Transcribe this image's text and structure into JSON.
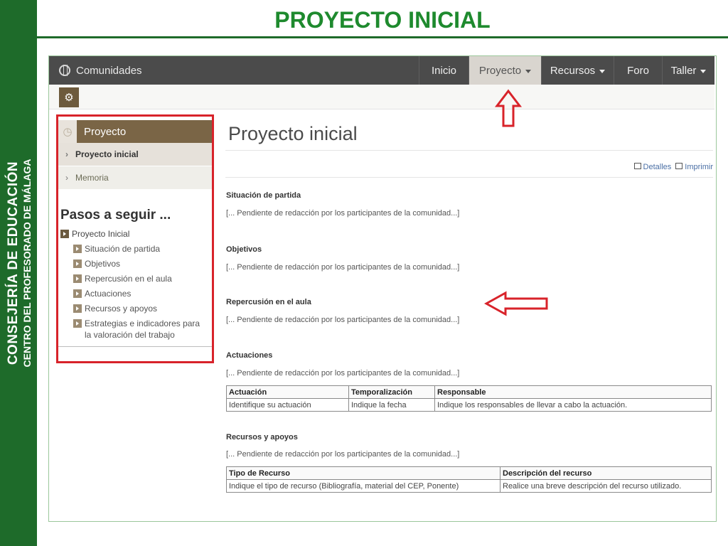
{
  "slide": {
    "title": "PROYECTO INICIAL",
    "band_line1": "CONSEJERÍA DE EDUCACIÓN",
    "band_line2": "CENTRO DEL PROFESORADO DE MÁLAGA"
  },
  "topbar": {
    "brand": "Comunidades",
    "nav": [
      {
        "label": "Inicio",
        "dropdown": false
      },
      {
        "label": "Proyecto",
        "dropdown": true
      },
      {
        "label": "Recursos",
        "dropdown": true
      },
      {
        "label": "Foro",
        "dropdown": false
      },
      {
        "label": "Taller",
        "dropdown": true
      }
    ]
  },
  "left_panel": {
    "header": "Proyecto",
    "items": [
      "Proyecto inicial",
      "Memoria"
    ],
    "pasos_title": "Pasos a seguir ...",
    "root_step": "Proyecto Inicial",
    "steps": [
      "Situación de partida",
      "Objetivos",
      "Repercusión en el aula",
      "Actuaciones",
      "Recursos y apoyos",
      "Estrategias e indicadores para la valoración del trabajo"
    ]
  },
  "main": {
    "title": "Proyecto inicial",
    "actions": {
      "details": "Detalles",
      "print": "Imprimir"
    },
    "pending_text": "[... Pendiente de redacción por los participantes de la comunidad...]",
    "sections": [
      {
        "title": "Situación de partida",
        "text": "[... Pendiente de redacción por los participantes de la comunidad...]"
      },
      {
        "title": "Objetivos",
        "text": "[... Pendiente de redacción por los participantes de la comunidad...]"
      },
      {
        "title": "Repercusión en el aula",
        "text": "[... Pendiente de redacción por los participantes de la comunidad...]"
      },
      {
        "title": "Actuaciones",
        "text": "[... Pendiente de redacción por los participantes de la comunidad...]"
      },
      {
        "title": "Recursos y apoyos",
        "text": "[... Pendiente de redacción por los participantes de la comunidad...]"
      }
    ],
    "actuaciones_table": {
      "headers": [
        "Actuación",
        "Temporalización",
        "Responsable"
      ],
      "row": [
        "Identifique su actuación",
        "Indique la fecha",
        "Indique los responsables de llevar a cabo la actuación."
      ]
    },
    "recursos_table": {
      "headers": [
        "Tipo de Recurso",
        "Descripción del recurso"
      ],
      "row": [
        "Indique el tipo de recurso (Bibliografía, material del CEP, Ponente)",
        "Realice una breve descripción del recurso utilizado."
      ]
    }
  },
  "colors": {
    "band_green": "#1e6b2a",
    "title_green": "#1e8a2e",
    "topbar": "#4b4b4b",
    "panel_brown": "#7a6546",
    "highlight_red": "#d8232a"
  }
}
